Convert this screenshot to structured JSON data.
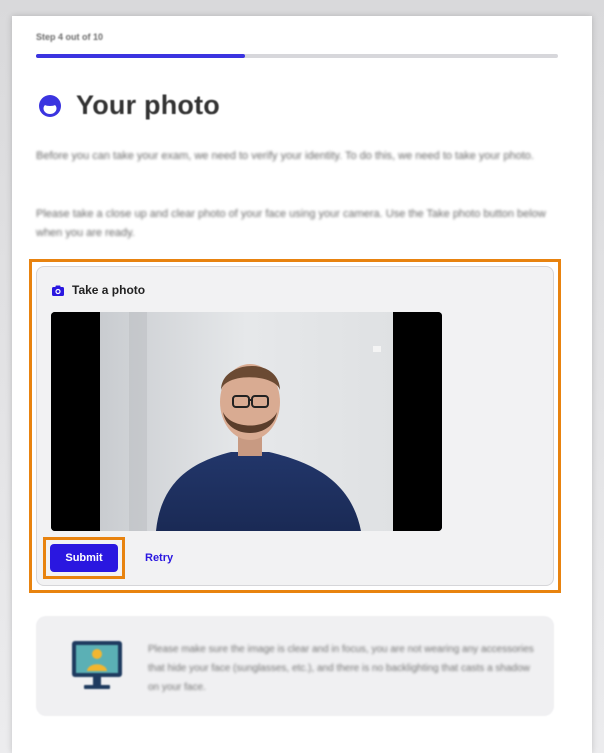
{
  "step": {
    "label": "Step 4 out of 10",
    "progress_fraction": 0.4
  },
  "header": {
    "title": "Your photo",
    "icon": "face-circle-icon"
  },
  "intro": {
    "paragraph1": "Before you can take your exam, we need to verify your identity. To do this, we need to take your photo.",
    "paragraph2": "Please take a close up and clear photo of your face using your camera. Use the Take photo button below when you are ready."
  },
  "photo_card": {
    "title": "Take a photo",
    "icon": "camera-icon",
    "submit_label": "Submit",
    "retry_label": "Retry"
  },
  "info": {
    "text": "Please make sure the image is clear and in focus, you are not wearing any accessories that hide your face (sunglasses, etc.), and there is no backlighting that casts a shadow on your face.",
    "icon": "person-on-monitor-icon"
  },
  "colors": {
    "accent": "#2a17e0",
    "highlight": "#e8830f"
  }
}
